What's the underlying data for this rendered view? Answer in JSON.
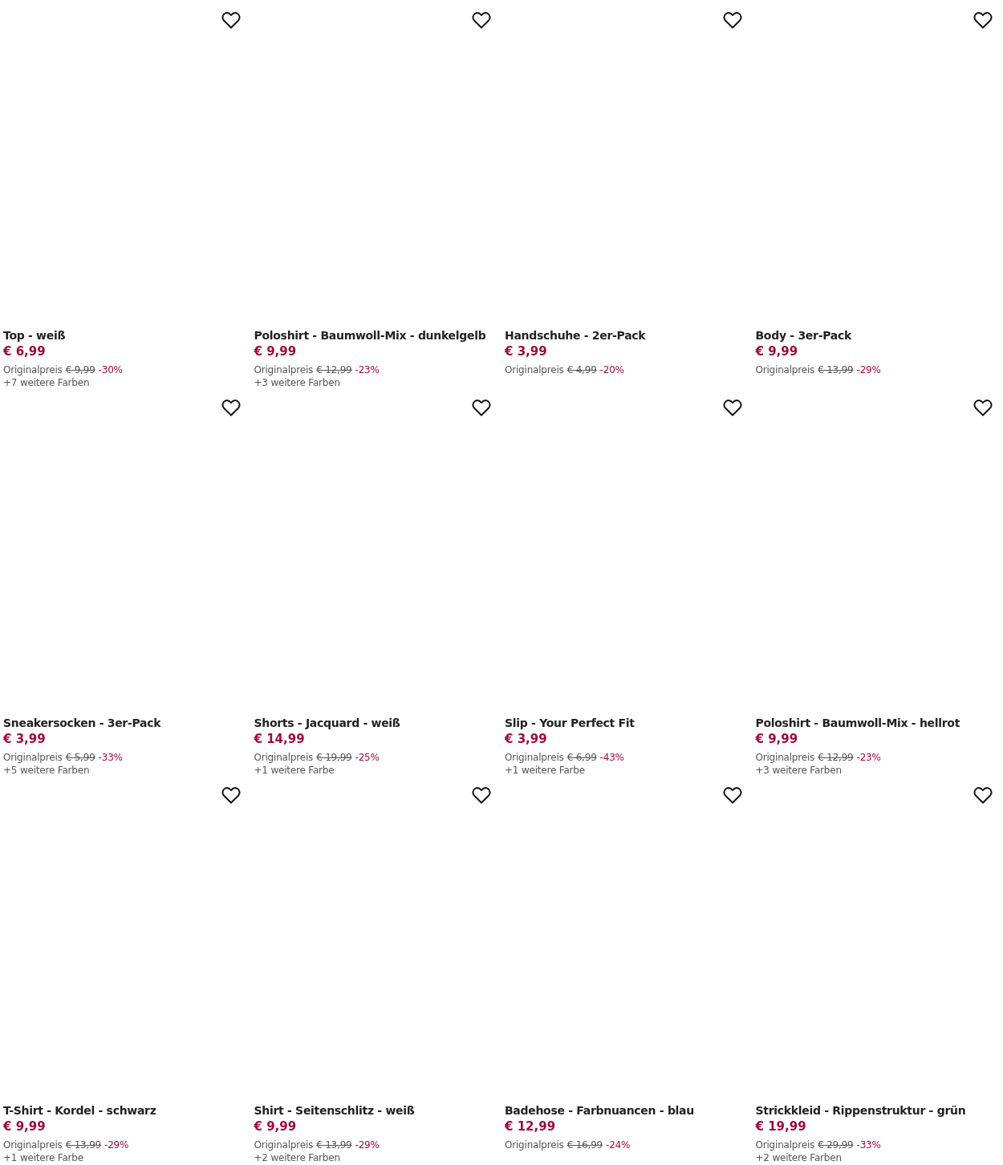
{
  "products": [
    {
      "title": "Top - weiß",
      "price": "€ 6,99",
      "original_label": "Originalpreis",
      "original_price": "€ 9,99",
      "discount": "-30%",
      "more_colors": "+7 weitere Farben"
    },
    {
      "title": "Poloshirt - Baumwoll-Mix - dunkelgelb",
      "price": "€ 9,99",
      "original_label": "Originalpreis",
      "original_price": "€ 12,99",
      "discount": "-23%",
      "more_colors": "+3 weitere Farben"
    },
    {
      "title": "Handschuhe - 2er-Pack",
      "price": "€ 3,99",
      "original_label": "Originalpreis",
      "original_price": "€ 4,99",
      "discount": "-20%"
    },
    {
      "title": "Body - 3er-Pack",
      "price": "€ 9,99",
      "original_label": "Originalpreis",
      "original_price": "€ 13,99",
      "discount": "-29%"
    },
    {
      "title": "Sneakersocken - 3er-Pack",
      "price": "€ 3,99",
      "original_label": "Originalpreis",
      "original_price": "€ 5,99",
      "discount": "-33%",
      "more_colors": "+5 weitere Farben"
    },
    {
      "title": "Shorts - Jacquard - weiß",
      "price": "€ 14,99",
      "original_label": "Originalpreis",
      "original_price": "€ 19,99",
      "discount": "-25%",
      "more_colors": "+1 weitere Farbe"
    },
    {
      "title": "Slip - Your Perfect Fit",
      "price": "€ 3,99",
      "original_label": "Originalpreis",
      "original_price": "€ 6,99",
      "discount": "-43%",
      "more_colors": "+1 weitere Farbe"
    },
    {
      "title": "Poloshirt - Baumwoll-Mix - hellrot",
      "price": "€ 9,99",
      "original_label": "Originalpreis",
      "original_price": "€ 12,99",
      "discount": "-23%",
      "more_colors": "+3 weitere Farben"
    },
    {
      "title": "T-Shirt - Kordel - schwarz",
      "price": "€ 9,99",
      "original_label": "Originalpreis",
      "original_price": "€ 13,99",
      "discount": "-29%",
      "more_colors": "+1 weitere Farbe"
    },
    {
      "title": "Shirt - Seitenschlitz - weiß",
      "price": "€ 9,99",
      "original_label": "Originalpreis",
      "original_price": "€ 13,99",
      "discount": "-29%",
      "more_colors": "+2 weitere Farben"
    },
    {
      "title": "Badehose - Farbnuancen - blau",
      "price": "€ 12,99",
      "original_label": "Originalpreis",
      "original_price": "€ 16,99",
      "discount": "-24%"
    },
    {
      "title": "Strickkleid - Rippenstruktur - grün",
      "price": "€ 19,99",
      "original_label": "Originalpreis",
      "original_price": "€ 29,99",
      "discount": "-33%",
      "more_colors": "+2 weitere Farben"
    }
  ]
}
